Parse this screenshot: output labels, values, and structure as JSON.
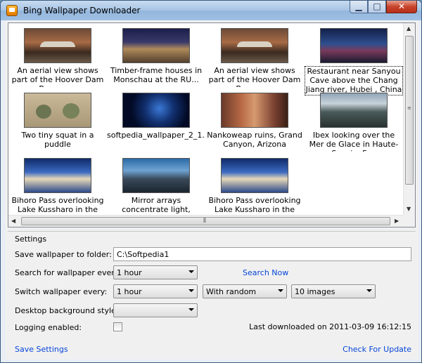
{
  "window": {
    "title": "Bing Wallpaper Downloader",
    "minimize_glyph": "▁",
    "maximize_glyph": "□",
    "close_glyph": "✕"
  },
  "gallery": {
    "items": [
      {
        "caption": "An aerial view shows part of the Hoover Dam Bypass ..."
      },
      {
        "caption": "Timber-frame houses in Monschau at the RU..."
      },
      {
        "caption": "An aerial view shows part of the Hoover Dam Bypass ..."
      },
      {
        "caption": "Restaurant near Sanyou Cave above the Chang Jiang river, Hubei , China"
      },
      {
        "caption": "Two tiny squat in a puddle"
      },
      {
        "caption": "softpedia_wallpaper_2_1..."
      },
      {
        "caption": "Nankoweap ruins, Grand Canyon, Arizona"
      },
      {
        "caption": "Ibex looking over the Mer de Glace in Haute-Savoie, Fr..."
      },
      {
        "caption": "Bihoro Pass overlooking Lake Kussharo in the Ak..."
      },
      {
        "caption": "Mirror arrays concentrate light, making electricity ne..."
      },
      {
        "caption": "Bihoro Pass overlooking Lake Kussharo in the Ak..."
      }
    ]
  },
  "settings": {
    "title": "Settings",
    "save_folder_label": "Save wallpaper to folder:",
    "save_folder_value": "C:\\Softpedia1",
    "search_every_label": "Search for wallpaper every:",
    "search_every_value": "1 hour",
    "search_now_label": "Search Now",
    "switch_every_label": "Switch wallpaper every:",
    "switch_every_value": "1 hour",
    "switch_mode_value": "With random",
    "switch_count_value": "10 images",
    "bg_style_label": "Desktop background style:",
    "bg_style_value": "",
    "logging_label": "Logging enabled:",
    "last_downloaded": "Last downloaded on 2011-03-09 16:12:15",
    "save_settings_label": "Save Settings",
    "check_update_label": "Check For Update"
  }
}
